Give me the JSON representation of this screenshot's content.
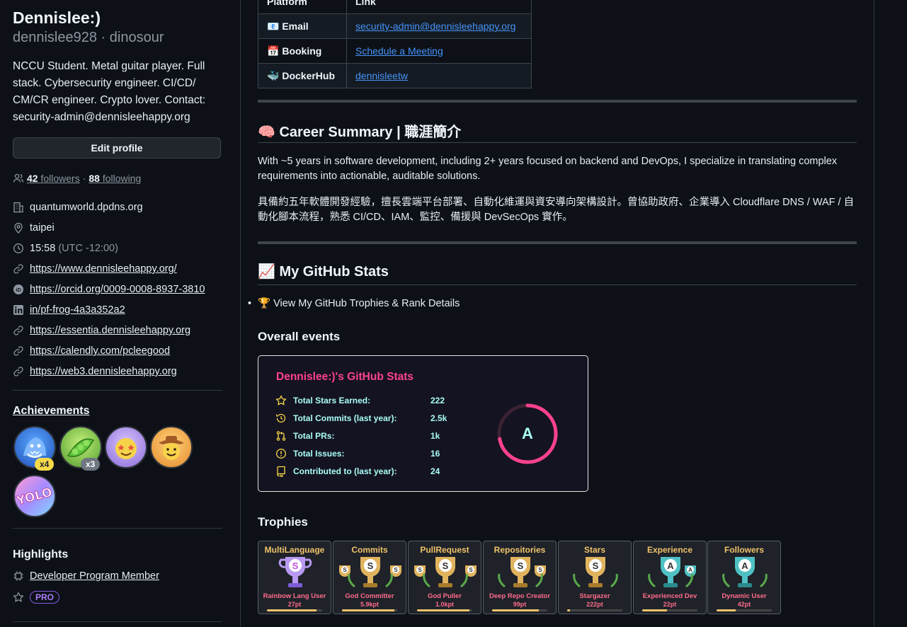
{
  "profile": {
    "display_name": "Dennislee:)",
    "username": "dennislee928",
    "pronouns": "dinosour",
    "separator": " · ",
    "bio": "NCCU Student. Metal guitar player. Full stack. Cybersecurity engineer. CI/CD/ CM/CR engineer. Crypto lover. Contact: security-admin@dennisleehappy.org",
    "edit_button": "Edit profile",
    "followers_count": "42",
    "followers_label": "followers",
    "following_count": "88",
    "following_label": "following",
    "dot": "·"
  },
  "info": {
    "company": "quantumworld.dpdns.org",
    "location": "taipei",
    "time": "15:58",
    "timezone": "(UTC -12:00)",
    "links": [
      "https://www.dennisleehappy.org/",
      "https://orcid.org/0009-0008-8937-3810",
      "in/pf-frog-4a3a352a2",
      "https://essentia.dennisleehappy.org",
      "https://calendly.com/pcleegood",
      "https://web3.dennisleehappy.org"
    ]
  },
  "achievements": {
    "title": "Achievements",
    "badges": [
      {
        "icon": "shark-badge-icon",
        "count": "x4",
        "count_color": "#f5d94a"
      },
      {
        "icon": "peas-badge-icon",
        "count": "x3",
        "count_color": "#6e7681"
      },
      {
        "icon": "starstruck-badge-icon",
        "count": ""
      },
      {
        "icon": "cowboy-badge-icon",
        "count": ""
      },
      {
        "icon": "yolo-badge-icon",
        "count": ""
      }
    ]
  },
  "highlights": {
    "title": "Highlights",
    "member": "Developer Program Member",
    "pro": "PRO"
  },
  "contact_table": {
    "header": [
      "Platform",
      "Link"
    ],
    "rows": [
      {
        "icon": "📧",
        "platform": "Email",
        "link": "security-admin@dennisleehappy.org"
      },
      {
        "icon": "📅",
        "platform": "Booking",
        "link": "Schedule a Meeting"
      },
      {
        "icon": "🐳",
        "platform": "DockerHub",
        "link": "dennisleetw"
      }
    ]
  },
  "career": {
    "title": "🧠 Career Summary | 職涯簡介",
    "para_en": "With ~5 years in software development, including 2+ years focused on backend and DevOps, I specialize in translating complex requirements into actionable, auditable solutions.",
    "para_zh": "具備約五年軟體開發經驗，擅長雲端平台部署、自動化維運與資安導向架構設計。曾協助政府、企業導入 Cloudflare DNS / WAF / 自動化腳本流程，熟悉 CI/CD、IAM、監控、備援與 DevSecOps 實作。"
  },
  "github_stats": {
    "title": "📈 My GitHub Stats",
    "trophy_link": "🏆 View My GitHub Trophies & Rank Details",
    "overall_title": "Overall events",
    "card": {
      "title": "Dennislee:)'s GitHub Stats",
      "rank": "A",
      "rank_progress": 0.72,
      "rows": [
        {
          "icon": "star-icon",
          "label": "Total Stars Earned:",
          "value": "222"
        },
        {
          "icon": "clock-icon",
          "label": "Total Commits (last year):",
          "value": "2.5k"
        },
        {
          "icon": "pull-request-icon",
          "label": "Total PRs:",
          "value": "1k"
        },
        {
          "icon": "issue-icon",
          "label": "Total Issues:",
          "value": "16"
        },
        {
          "icon": "repo-icon",
          "label": "Contributed to (last year):",
          "value": "24"
        }
      ]
    },
    "trophies_title": "Trophies",
    "trophies": [
      {
        "title": "MultiLanguage",
        "rank": "S",
        "name": "Rainbow Lang User",
        "points": "27pt",
        "progress": 0.9,
        "style": "purple"
      },
      {
        "title": "Commits",
        "rank": "S",
        "name": "God Committer",
        "points": "5.9kpt",
        "progress": 0.95,
        "style": "gold"
      },
      {
        "title": "PullRequest",
        "rank": "S",
        "name": "God Puller",
        "points": "1.0kpt",
        "progress": 0.95,
        "style": "gold"
      },
      {
        "title": "Repositories",
        "rank": "S",
        "name": "Deep Repo Creator",
        "points": "99pt",
        "progress": 0.85,
        "style": "gold-single"
      },
      {
        "title": "Stars",
        "rank": "S",
        "name": "Stargazer",
        "points": "222pt",
        "progress": 0.05,
        "style": "gold-plain"
      },
      {
        "title": "Experience",
        "rank": "A",
        "name": "Experienced Dev",
        "points": "22pt",
        "progress": 0.45,
        "style": "teal"
      },
      {
        "title": "Followers",
        "rank": "A",
        "name": "Dynamic User",
        "points": "42pt",
        "progress": 0.35,
        "style": "teal-plain"
      }
    ]
  },
  "colors": {
    "accent_link": "#4493f8",
    "stats_title": "#fe428e",
    "stats_text": "#a9fef7",
    "stats_icon": "#f8d847"
  }
}
